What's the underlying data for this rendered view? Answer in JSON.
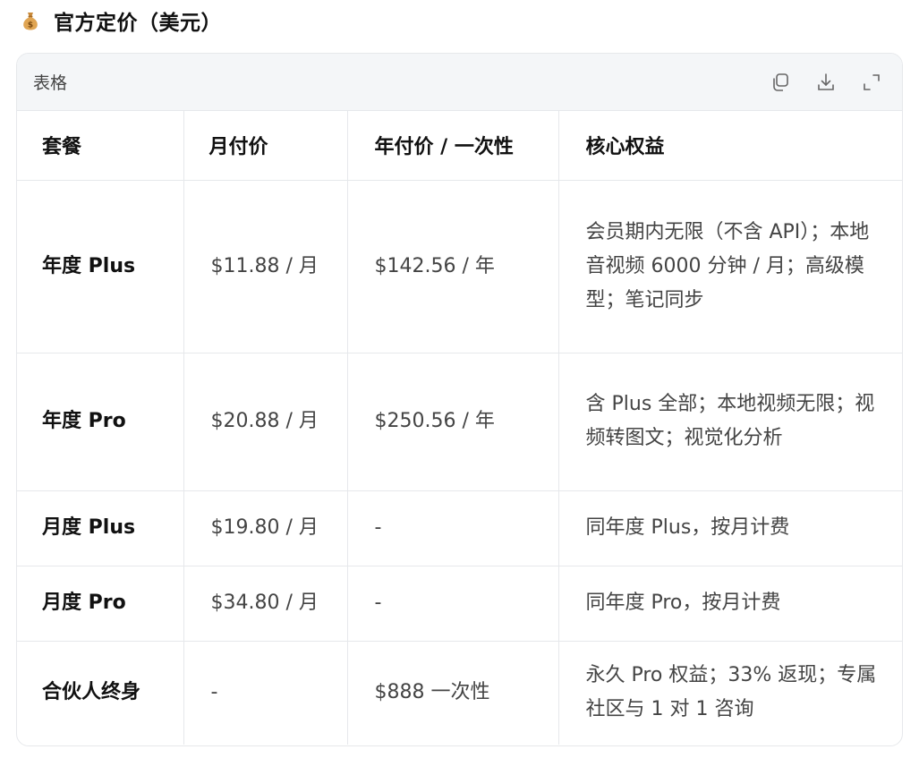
{
  "heading": {
    "icon": "money-bag-icon",
    "title": "官方定价（美元）"
  },
  "card": {
    "label": "表格",
    "actions": [
      {
        "name": "copy-button",
        "icon": "copy-icon"
      },
      {
        "name": "download-button",
        "icon": "download-icon"
      },
      {
        "name": "expand-button",
        "icon": "expand-icon"
      }
    ]
  },
  "table": {
    "headers": [
      "套餐",
      "月付价",
      "年付价 / 一次性",
      "核心权益"
    ],
    "rows": [
      [
        "年度 Plus",
        "$11.88 / 月",
        "$142.56 / 年",
        "会员期内无限（不含 API）；本地音视频 6000 分钟 / 月；高级模型；笔记同步"
      ],
      [
        "年度 Pro",
        "$20.88 / 月",
        "$250.56 / 年",
        "含 Plus 全部；本地视频无限；视频转图文；视觉化分析"
      ],
      [
        "月度 Plus",
        "$19.80 / 月",
        "-",
        "同年度 Plus，按月计费"
      ],
      [
        "月度 Pro",
        "$34.80 / 月",
        "-",
        "同年度 Pro，按月计费"
      ],
      [
        "合伙人终身",
        "-",
        "$888 一次性",
        "永久 Pro 权益；33% 返现；专属社区与 1 对 1 咨询"
      ]
    ]
  },
  "colors": {
    "toolbar_bg": "#f4f6f8",
    "border": "#e6e8eb",
    "text_primary": "#111111",
    "text_secondary": "#444444"
  }
}
